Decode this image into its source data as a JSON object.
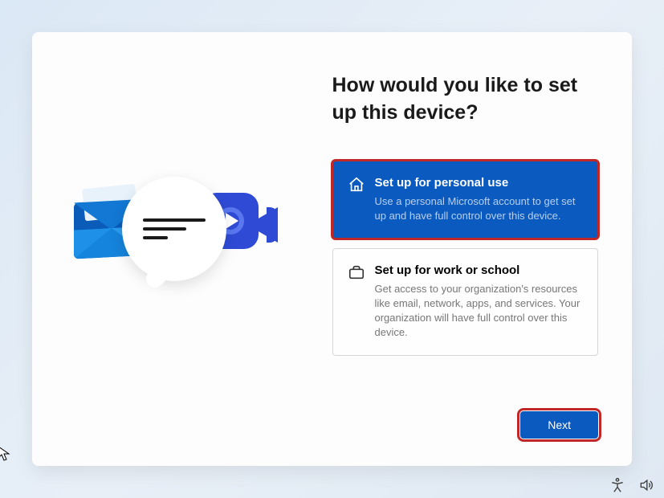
{
  "heading": "How would you like to set up this device?",
  "options": {
    "personal": {
      "title": "Set up for personal use",
      "desc": "Use a personal Microsoft account to get set up and have full control over this device."
    },
    "work": {
      "title": "Set up for work or school",
      "desc": "Get access to your organization's resources like email, network, apps, and services. Your organization will have full control over this device."
    }
  },
  "footer": {
    "next": "Next"
  }
}
